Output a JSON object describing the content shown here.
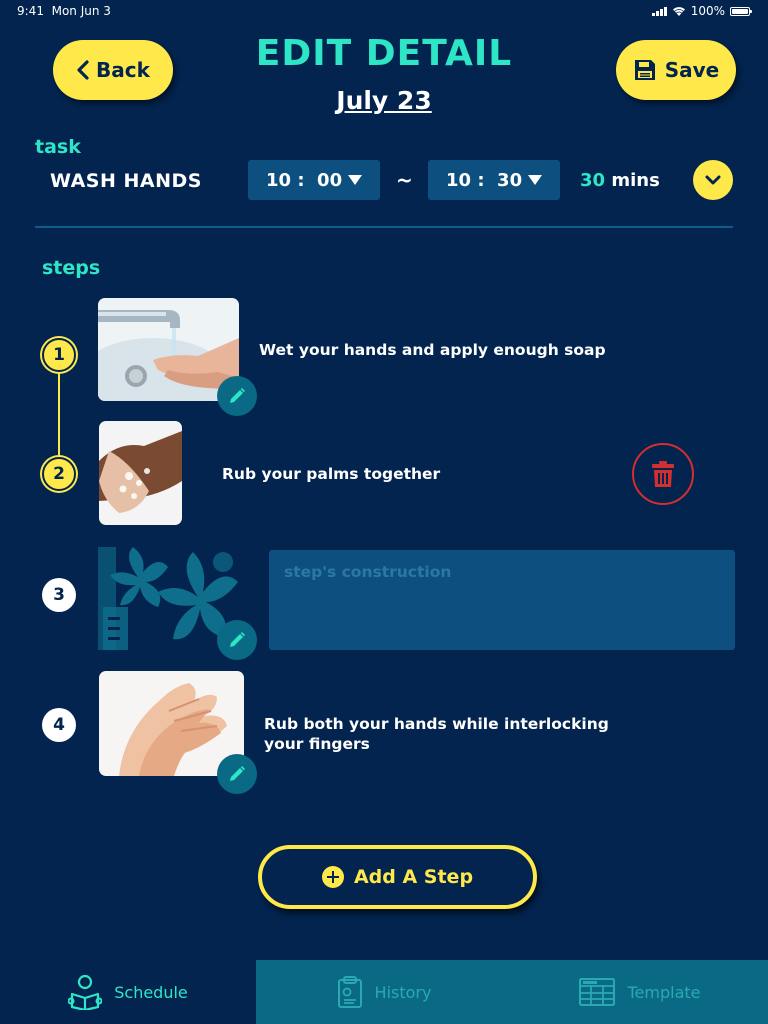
{
  "status_bar": {
    "time": "9:41",
    "date": "Mon Jun 3",
    "battery": "100%"
  },
  "header": {
    "back_label": "Back",
    "save_label": "Save",
    "title": "EDIT DETAIL",
    "date": "July 23"
  },
  "task": {
    "section_label": "task",
    "name": "WASH HANDS",
    "start_time": "10 :  00",
    "separator": "~",
    "end_time": "10 :  30",
    "duration_value": "30",
    "duration_unit": "mins"
  },
  "steps": {
    "section_label": "steps",
    "items": [
      {
        "number": "1",
        "text": "Wet your hands and apply enough soap",
        "state": "active"
      },
      {
        "number": "2",
        "text": "Rub your palms together",
        "state": "active"
      },
      {
        "number": "3",
        "placeholder": "step's construction",
        "state": "idle"
      },
      {
        "number": "4",
        "text": "Rub both your hands while  interlocking your fingers",
        "state": "idle"
      }
    ]
  },
  "add_step_label": "Add A Step",
  "tabs": [
    {
      "label": "Schedule",
      "icon": "reader-icon",
      "active": true
    },
    {
      "label": "History",
      "icon": "clipboard-icon",
      "active": false
    },
    {
      "label": "Template",
      "icon": "table-icon",
      "active": false
    }
  ],
  "colors": {
    "background": "#02244f",
    "accent_yellow": "#ffe94a",
    "accent_teal": "#2ee6c6",
    "field_blue": "#0d4f7f",
    "tab_inactive": "#0a6a85",
    "delete_red": "#d32f2f"
  }
}
